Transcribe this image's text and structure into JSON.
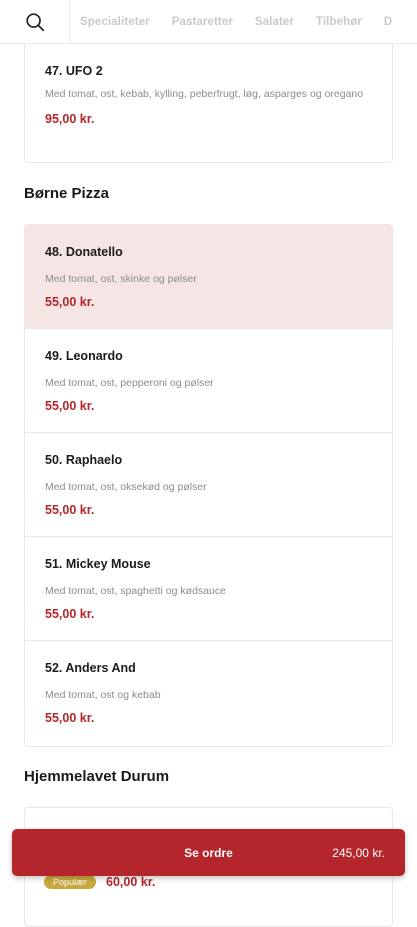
{
  "categories": [
    "Specialiteter",
    "Pastaretter",
    "Salater",
    "Tilbehør",
    "D"
  ],
  "top_item": {
    "name": "47. UFO 2",
    "desc": "Med tomat, ost, kebab, kylling, peberfrugt, løg, asparges og oregano",
    "price": "95,00 kr."
  },
  "section_borne": "Børne Pizza",
  "borne_items": [
    {
      "name": "48. Donatello",
      "desc": "Med tomat, ost, skinke og pølser",
      "price": "55,00 kr."
    },
    {
      "name": "49. Leonardo",
      "desc": "Med tomat, ost, pepperoni og pølser",
      "price": "55,00 kr."
    },
    {
      "name": "50. Raphaelo",
      "desc": "Med tomat, ost, oksekød og pølser",
      "price": "55,00 kr."
    },
    {
      "name": "51. Mickey Mouse",
      "desc": "Med tomat, ost, spaghetti og kødsauce",
      "price": "55,00 kr."
    },
    {
      "name": "52. Anders And",
      "desc": "Med tomat, ost og kebab",
      "price": "55,00 kr."
    }
  ],
  "section_durum": "Hjemmelavet Durum",
  "durum_item": {
    "badge": "Populær",
    "price": "60,00 kr."
  },
  "order": {
    "label": "Se ordre",
    "total": "245,00 kr."
  },
  "colors": {
    "accent": "#b4262b",
    "highlight_bg": "#f6e5e5",
    "badge": "#c9a93e"
  }
}
